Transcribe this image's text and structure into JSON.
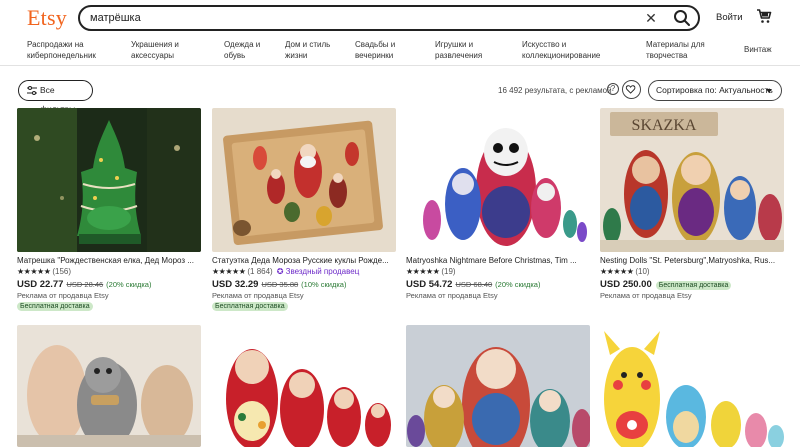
{
  "header": {
    "logo": "Etsy",
    "search_value": "матрёшка",
    "signin_label": "Войти"
  },
  "nav": {
    "items": [
      {
        "label": "Распродажи на киберпонедельник"
      },
      {
        "label": "Украшения и аксессуары"
      },
      {
        "label": "Одежда и обувь"
      },
      {
        "label": "Дом и стиль жизни"
      },
      {
        "label": "Свадьбы и вечеринки"
      },
      {
        "label": "Игрушки и развлечения"
      },
      {
        "label": "Искусство и коллекционирование"
      },
      {
        "label": "Материалы для творчества"
      },
      {
        "label": "Винтаж"
      }
    ]
  },
  "toolbar": {
    "filters_label": "Все фильтры",
    "result_count": "16 492 результата, с рекламой",
    "help_label": "?",
    "sort_label": "Сортировка по: Актуальность"
  },
  "listings": [
    {
      "title": "Матрешка \"Рождественская елка, Дед Мороз ...",
      "stars": "★★★★★",
      "reviews": "(156)",
      "star_seller": "",
      "price": "USD 22.77",
      "old_price": "USD 28.46",
      "discount": "(20% скидка)",
      "ad": "Реклама от продавца Etsy",
      "free_shipping": "Бесплатная доставка",
      "free_shipping_inline": ""
    },
    {
      "title": "Статуэтка Деда Мороза Русские куклы Рожде...",
      "stars": "★★★★★",
      "reviews": "(1 864)",
      "star_seller": "✪ Звездный продавец",
      "price": "USD 32.29",
      "old_price": "USD 35.88",
      "discount": "(10% скидка)",
      "ad": "Реклама от продавца Etsy",
      "free_shipping": "Бесплатная доставка",
      "free_shipping_inline": ""
    },
    {
      "title": "Matryoshka Nightmare Before Christmas, Tim ...",
      "stars": "★★★★★",
      "reviews": "(19)",
      "star_seller": "",
      "price": "USD 54.72",
      "old_price": "USD 68.40",
      "discount": "(20% скидка)",
      "ad": "Реклама от продавца Etsy",
      "free_shipping": "",
      "free_shipping_inline": ""
    },
    {
      "title": "Nesting Dolls \"St. Petersburg\",Matryoshka, Rus...",
      "stars": "★★★★★",
      "reviews": "(10)",
      "star_seller": "",
      "price": "USD 250.00",
      "old_price": "",
      "discount": "",
      "ad": "Реклама от продавца Etsy",
      "free_shipping": "",
      "free_shipping_inline": "Бесплатная доставка"
    }
  ],
  "image_overlays": {
    "card4_sign": "SKAZKA"
  },
  "colors": {
    "brand": "#f1641e",
    "free_shipping_bg": "#cde8c8",
    "star_seller": "#6e2cc9",
    "discount": "#2a7a34"
  }
}
